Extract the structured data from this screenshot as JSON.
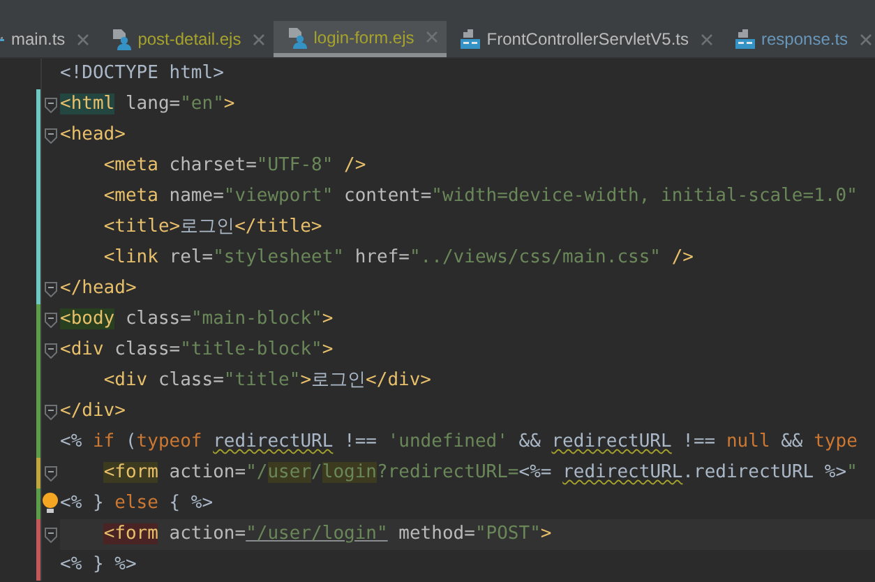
{
  "tabs": [
    {
      "label": "main.ts",
      "kind": "ts",
      "color": "#bbbbbb",
      "selected": false
    },
    {
      "label": "post-detail.ejs",
      "kind": "ejs",
      "color": "#a6a32d",
      "selected": false
    },
    {
      "label": "login-form.ejs",
      "kind": "ejs",
      "color": "#a6a32d",
      "selected": true
    },
    {
      "label": "FrontControllerServletV5.ts",
      "kind": "ts",
      "color": "#bbbbbb",
      "selected": false
    },
    {
      "label": "response.ts",
      "kind": "ts",
      "color": "#6897bb",
      "selected": false
    }
  ],
  "editor": {
    "lines": [
      {
        "fold": false,
        "current": false,
        "bulb": false,
        "tokens": [
          {
            "text": "<!DOCTYPE html>",
            "kind": "plain"
          }
        ]
      },
      {
        "color": "#6fc9c3",
        "fold": true,
        "current": false,
        "bulb": false,
        "tokens": [
          {
            "text": "<html",
            "kind": "tag",
            "color": "#244640"
          },
          {
            "text": " lang=",
            "kind": "attr"
          },
          {
            "text": "\"en\"",
            "kind": "str"
          },
          {
            "text": ">",
            "kind": "tag"
          }
        ]
      },
      {
        "color": "#6fc9c3",
        "fold": true,
        "current": false,
        "bulb": false,
        "tokens": [
          {
            "text": "<head>",
            "kind": "tag"
          }
        ]
      },
      {
        "color": "#6fc9c3",
        "fold": false,
        "current": false,
        "bulb": false,
        "tokens": [
          {
            "text": "    <meta",
            "kind": "tag"
          },
          {
            "text": " charset=",
            "kind": "attr"
          },
          {
            "text": "\"UTF-8\"",
            "kind": "str"
          },
          {
            "text": " />",
            "kind": "tag"
          }
        ]
      },
      {
        "color": "#6fc9c3",
        "fold": false,
        "current": false,
        "bulb": false,
        "tokens": [
          {
            "text": "    <meta",
            "kind": "tag"
          },
          {
            "text": " name=",
            "kind": "attr"
          },
          {
            "text": "\"viewport\"",
            "kind": "str"
          },
          {
            "text": " content=",
            "kind": "attr"
          },
          {
            "text": "\"width=device-width, initial-scale=1.0\"",
            "kind": "str"
          }
        ]
      },
      {
        "color": "#6fc9c3",
        "fold": false,
        "current": false,
        "bulb": false,
        "tokens": [
          {
            "text": "    <title>",
            "kind": "tag"
          },
          {
            "text": "로그인",
            "kind": "plain"
          },
          {
            "text": "</title>",
            "kind": "tag"
          }
        ]
      },
      {
        "color": "#6fc9c3",
        "fold": false,
        "current": false,
        "bulb": false,
        "tokens": [
          {
            "text": "    <link",
            "kind": "tag"
          },
          {
            "text": " rel=",
            "kind": "attr"
          },
          {
            "text": "\"stylesheet\"",
            "kind": "str"
          },
          {
            "text": " href=",
            "kind": "attr"
          },
          {
            "text": "\"../views/css/main.css\"",
            "kind": "str"
          },
          {
            "text": " />",
            "kind": "tag"
          }
        ]
      },
      {
        "color": "#6fc9c3",
        "fold": true,
        "current": false,
        "bulb": false,
        "tokens": [
          {
            "text": "</head>",
            "kind": "tag"
          }
        ]
      },
      {
        "color": "#5c9d4a",
        "fold": true,
        "current": false,
        "bulb": false,
        "tokens": [
          {
            "text": "<body",
            "kind": "tag",
            "color": "#28401f"
          },
          {
            "text": " class=",
            "kind": "attr"
          },
          {
            "text": "\"main-block\"",
            "kind": "str"
          },
          {
            "text": ">",
            "kind": "tag"
          }
        ]
      },
      {
        "color": "#5c9d4a",
        "fold": true,
        "current": false,
        "bulb": false,
        "tokens": [
          {
            "text": "<div",
            "kind": "tag"
          },
          {
            "text": " class=",
            "kind": "attr"
          },
          {
            "text": "\"title-block\"",
            "kind": "str"
          },
          {
            "text": ">",
            "kind": "tag"
          }
        ]
      },
      {
        "color": "#5c9d4a",
        "fold": false,
        "current": false,
        "bulb": false,
        "tokens": [
          {
            "text": "    <div",
            "kind": "tag"
          },
          {
            "text": " class=",
            "kind": "attr"
          },
          {
            "text": "\"title\"",
            "kind": "str"
          },
          {
            "text": ">",
            "kind": "tag"
          },
          {
            "text": "로그인",
            "kind": "plain"
          },
          {
            "text": "</div>",
            "kind": "tag"
          }
        ]
      },
      {
        "color": "#5c9d4a",
        "fold": true,
        "current": false,
        "bulb": false,
        "tokens": [
          {
            "text": "</div>",
            "kind": "tag"
          }
        ]
      },
      {
        "color": "#5c9d4a",
        "fold": false,
        "current": false,
        "bulb": false,
        "tokens": [
          {
            "text": "<% ",
            "kind": "plain"
          },
          {
            "text": "if",
            "kind": "kw"
          },
          {
            "text": " (",
            "kind": "plain"
          },
          {
            "text": "typeof ",
            "kind": "kw"
          },
          {
            "text": "redirectURL",
            "kind": "plain",
            "warning": true
          },
          {
            "text": " !== ",
            "kind": "plain"
          },
          {
            "text": "'undefined'",
            "kind": "str"
          },
          {
            "text": " && ",
            "kind": "plain"
          },
          {
            "text": "redirectURL",
            "kind": "plain",
            "warning": true
          },
          {
            "text": " !== ",
            "kind": "plain"
          },
          {
            "text": "null",
            "kind": "kw"
          },
          {
            "text": " && ",
            "kind": "plain"
          },
          {
            "text": "type",
            "kind": "kw"
          }
        ]
      },
      {
        "color": "#bfa73e",
        "fold": true,
        "current": false,
        "bulb": false,
        "tokens": [
          {
            "text": "    <form",
            "kind": "tag",
            "color": "#3d3b1f"
          },
          {
            "text": " action=",
            "kind": "attr"
          },
          {
            "text": "\"/",
            "kind": "str"
          },
          {
            "text": "user",
            "kind": "str",
            "color": "#3d3b1f"
          },
          {
            "text": "/",
            "kind": "str"
          },
          {
            "text": "login",
            "kind": "str",
            "color": "#3d3b1f"
          },
          {
            "text": "?redirectURL=",
            "kind": "str"
          },
          {
            "text": "<%= ",
            "kind": "plain"
          },
          {
            "text": "redirectURL",
            "kind": "plain",
            "warning": true
          },
          {
            "text": ".redirectURL %>",
            "kind": "plain"
          },
          {
            "text": "\"",
            "kind": "str"
          }
        ]
      },
      {
        "color": "#5c9d4a",
        "fold": false,
        "current": false,
        "bulb": true,
        "tokens": [
          {
            "text": "<% } ",
            "kind": "plain"
          },
          {
            "text": "else",
            "kind": "kw"
          },
          {
            "text": " { %>",
            "kind": "plain"
          }
        ]
      },
      {
        "color": "#c2585a",
        "fold": true,
        "current": true,
        "bulb": false,
        "tokens": [
          {
            "text": "    <form",
            "kind": "tag",
            "color": "#4a2424"
          },
          {
            "text": " action=",
            "kind": "attr"
          },
          {
            "text": "\"/user/login\"",
            "kind": "str",
            "underlined": true
          },
          {
            "text": " method=",
            "kind": "attr"
          },
          {
            "text": "\"POST\"",
            "kind": "str"
          },
          {
            "text": ">",
            "kind": "tag"
          }
        ]
      },
      {
        "color": "#c2585a",
        "fold": false,
        "current": false,
        "bulb": false,
        "tokens": [
          {
            "text": "<% } %>",
            "kind": "plain"
          }
        ]
      }
    ]
  }
}
